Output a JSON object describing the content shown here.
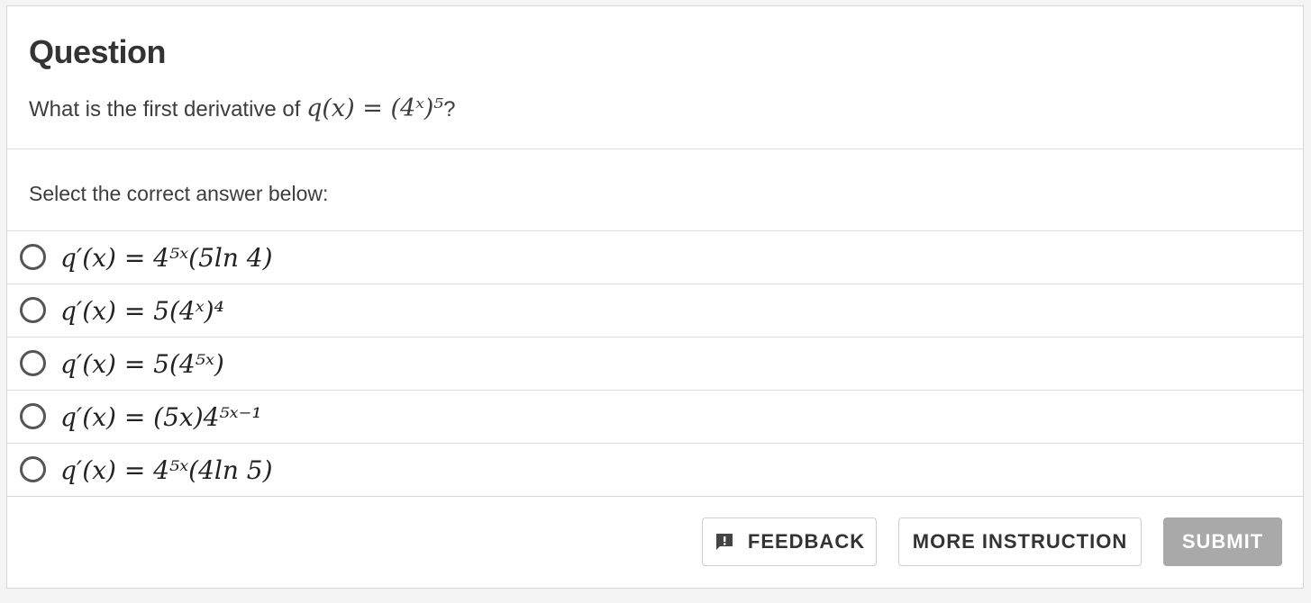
{
  "header": {
    "title": "Question",
    "question_prefix": "What is the first derivative of ",
    "question_math": "q(x) = (4ˣ)⁵",
    "question_suffix": "?"
  },
  "prompt": "Select the correct answer below:",
  "options": [
    {
      "label": "q′(x) = 4⁵ˣ(5ln 4)"
    },
    {
      "label": "q′(x) = 5(4ˣ)⁴"
    },
    {
      "label": "q′(x) = 5(4⁵ˣ)"
    },
    {
      "label": "q′(x) = (5x)4⁵ˣ⁻¹"
    },
    {
      "label": "q′(x) = 4⁵ˣ(4ln 5)"
    }
  ],
  "actions": {
    "feedback_label": "FEEDBACK",
    "more_label": "MORE INSTRUCTION",
    "submit_label": "SUBMIT",
    "feedback_icon": "feedback-icon"
  },
  "colors": {
    "submit_disabled_bg": "#a9a9a9",
    "border": "#dedede"
  }
}
